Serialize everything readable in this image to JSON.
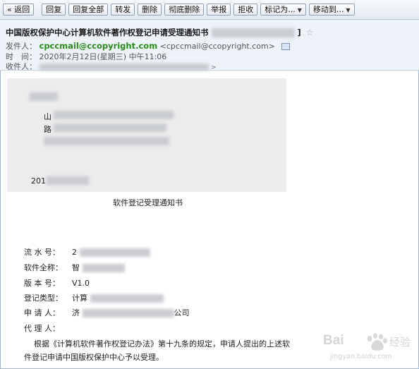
{
  "toolbar": {
    "back": "« 返回",
    "reply": "回复",
    "reply_all": "回复全部",
    "forward": "转发",
    "delete": "删除",
    "perm_delete": "彻底删除",
    "report": "举报",
    "reject": "拒收",
    "mark_as": "标记为...",
    "move_to": "移动到..."
  },
  "header": {
    "subject": "中国版权保护中心计算机软件著作权登记申请受理通知书",
    "subject_close": "]",
    "from_label": "发件人：",
    "from_name": "cpccmail@ccopyright.com",
    "from_addr": "<cpccmail@ccopyright.com>",
    "time_label": "时　间：",
    "time_value": "2020年2月12日(星期三) 中午11:06",
    "to_label": "收件人："
  },
  "letter": {
    "line1_prefix": "山",
    "line2_prefix": "路",
    "date_prefix": "201"
  },
  "body": {
    "caption": "软件登记受理通知书",
    "fields": [
      {
        "label": "流 水 号：",
        "value": "2"
      },
      {
        "label": "软件全称：",
        "value": "智"
      },
      {
        "label": "版 本 号：",
        "value": "V1.0"
      },
      {
        "label": "登记类型：",
        "value": "计算"
      },
      {
        "label": "申 请 人：",
        "value": "济",
        "suffix": "公司"
      },
      {
        "label": "代 理 人：",
        "value": ""
      }
    ],
    "paragraph": "根据《计算机软件著作权登记办法》第十九条的规定，申请人提出的上述软件登记申请中国版权保护中心予以受理。"
  },
  "watermark": {
    "brand": "Bai",
    "brand2": "经验",
    "url": "jingyan.baidu.com"
  },
  "colors": {
    "accent": "#2a8a1a",
    "header_bg": "#eef3fa",
    "toolbar_bg": "#e3eaf4"
  }
}
